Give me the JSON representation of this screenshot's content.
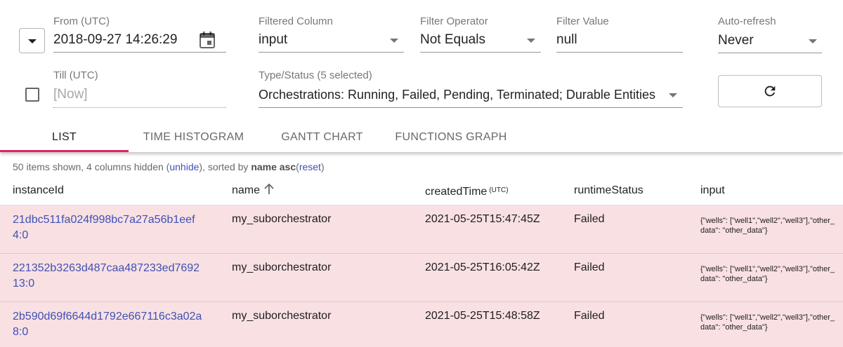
{
  "filters": {
    "from": {
      "label": "From (UTC)",
      "value": "2018-09-27 14:26:29"
    },
    "till": {
      "label": "Till (UTC)",
      "placeholder": "[Now]"
    },
    "filtered_column": {
      "label": "Filtered Column",
      "value": "input"
    },
    "filter_operator": {
      "label": "Filter Operator",
      "value": "Not Equals"
    },
    "filter_value": {
      "label": "Filter Value",
      "value": "null"
    },
    "auto_refresh": {
      "label": "Auto-refresh",
      "value": "Never"
    },
    "type_status": {
      "label": "Type/Status (5 selected)",
      "value": "Orchestrations: Running, Failed, Pending, Terminated; Durable Entities"
    }
  },
  "tabs": [
    {
      "label": "List",
      "active": true
    },
    {
      "label": "Time Histogram",
      "active": false
    },
    {
      "label": "Gantt Chart",
      "active": false
    },
    {
      "label": "Functions Graph",
      "active": false
    }
  ],
  "summary": {
    "prefix": "50 items shown, 4 columns hidden (",
    "unhide": "unhide",
    "middle": "), sorted by ",
    "sort": "name asc",
    "open": "(",
    "reset": "reset",
    "close": ")"
  },
  "table": {
    "columns": {
      "instanceId": "instanceId",
      "name": "name",
      "createdTime": "createdTime",
      "createdTime_unit": "(UTC)",
      "runtimeStatus": "runtimeStatus",
      "input": "input"
    },
    "rows": [
      {
        "instanceId": "21dbc511fa024f998bc7a27a56b1eef4:0",
        "name": "my_suborchestrator",
        "createdTime": "2021-05-25T15:47:45Z",
        "runtimeStatus": "Failed",
        "input": "{\"wells\": [\"well1\",\"well2\",\"well3\"],\"other_data\": \"other_data\"}"
      },
      {
        "instanceId": "221352b3263d487caa487233ed769213:0",
        "name": "my_suborchestrator",
        "createdTime": "2021-05-25T16:05:42Z",
        "runtimeStatus": "Failed",
        "input": "{\"wells\": [\"well1\",\"well2\",\"well3\"],\"other_data\": \"other_data\"}"
      },
      {
        "instanceId": "2b590d69f6644d1792e667116c3a02a8:0",
        "name": "my_suborchestrator",
        "createdTime": "2021-05-25T15:48:58Z",
        "runtimeStatus": "Failed",
        "input": "{\"wells\": [\"well1\",\"well2\",\"well3\"],\"other_data\": \"other_data\"}"
      }
    ]
  },
  "icons": {
    "expand": "chevron-down-icon",
    "calendar": "calendar-icon",
    "refresh": "refresh-icon",
    "sort": "arrow-upward-icon"
  },
  "colors": {
    "accent": "#e0245e",
    "link": "#3f51b5",
    "failed_row": "#f8e0e3"
  }
}
